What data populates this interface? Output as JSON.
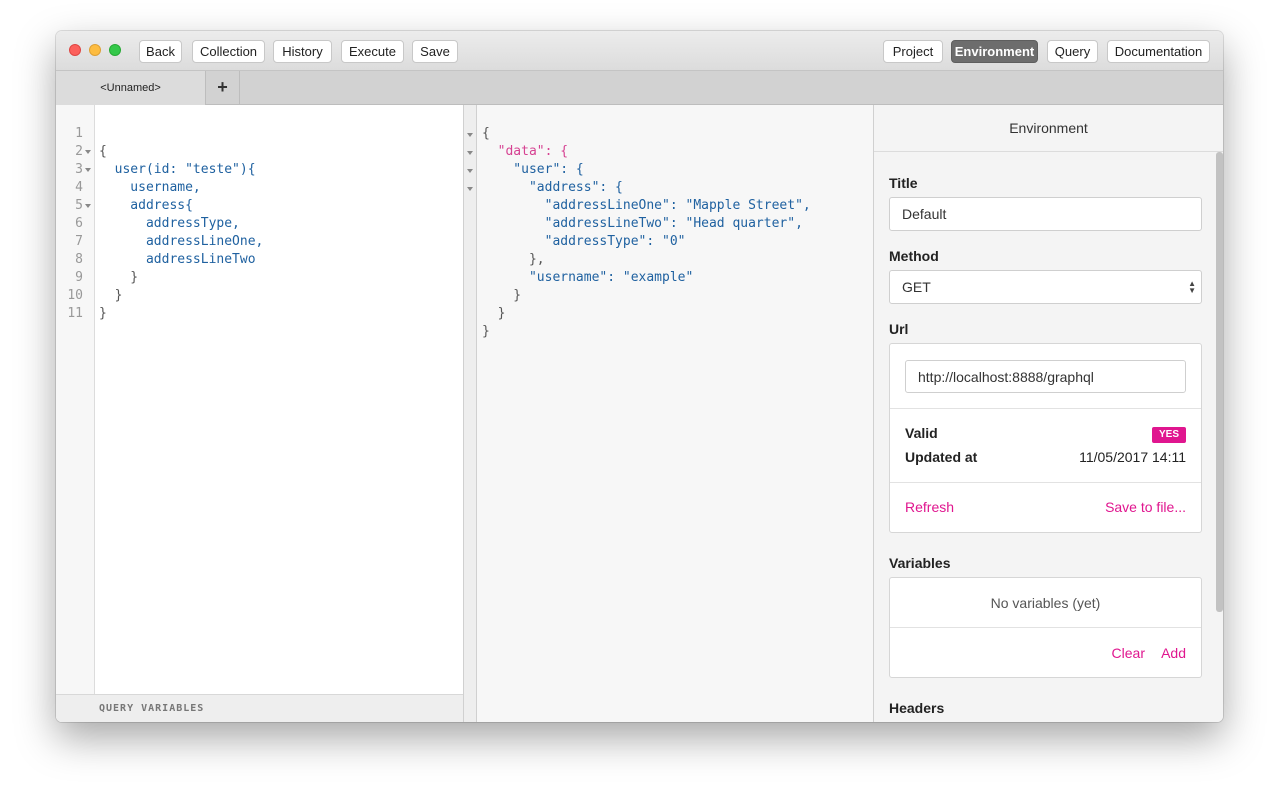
{
  "toolbar": {
    "left_buttons": [
      "Back",
      "Collection",
      "History",
      "Execute",
      "Save"
    ],
    "right_buttons": [
      "Project",
      "Environment",
      "Query",
      "Documentation"
    ],
    "active_right": "Environment"
  },
  "tabs": {
    "items": [
      "<Unnamed>"
    ],
    "add_label": "+"
  },
  "query_editor": {
    "line_numbers": [
      "1",
      "2",
      "3",
      "4",
      "5",
      "6",
      "7",
      "8",
      "9",
      "10",
      "11"
    ],
    "lines": [
      "",
      "{",
      "  user(id: \"teste\"){",
      "    username,",
      "    address{",
      "      addressType,",
      "      addressLineOne,",
      "      addressLineTwo",
      "    }",
      "  }",
      "}"
    ],
    "query_variables_label": "QUERY VARIABLES"
  },
  "result": {
    "lines": [
      "{",
      "  \"data\": {",
      "    \"user\": {",
      "      \"address\": {",
      "        \"addressLineOne\": \"Mapple Street\",",
      "        \"addressLineTwo\": \"Head quarter\",",
      "        \"addressType\": \"0\"",
      "      },",
      "      \"username\": \"example\"",
      "    }",
      "  }",
      "}"
    ]
  },
  "environment": {
    "header": "Environment",
    "title_label": "Title",
    "title_value": "Default",
    "method_label": "Method",
    "method_value": "GET",
    "url_label": "Url",
    "url_value": "http://localhost:8888/graphql",
    "valid_label": "Valid",
    "valid_badge": "YES",
    "updated_label": "Updated at",
    "updated_value": "11/05/2017 14:11",
    "refresh_label": "Refresh",
    "save_label": "Save to file...",
    "variables_label": "Variables",
    "no_variables": "No variables (yet)",
    "clear_label": "Clear",
    "add_label": "Add",
    "headers_label": "Headers"
  },
  "colors": {
    "accent": "#e0168f",
    "field": "#1f61a0",
    "string": "#d64292",
    "attribute": "#8b2bb9"
  }
}
